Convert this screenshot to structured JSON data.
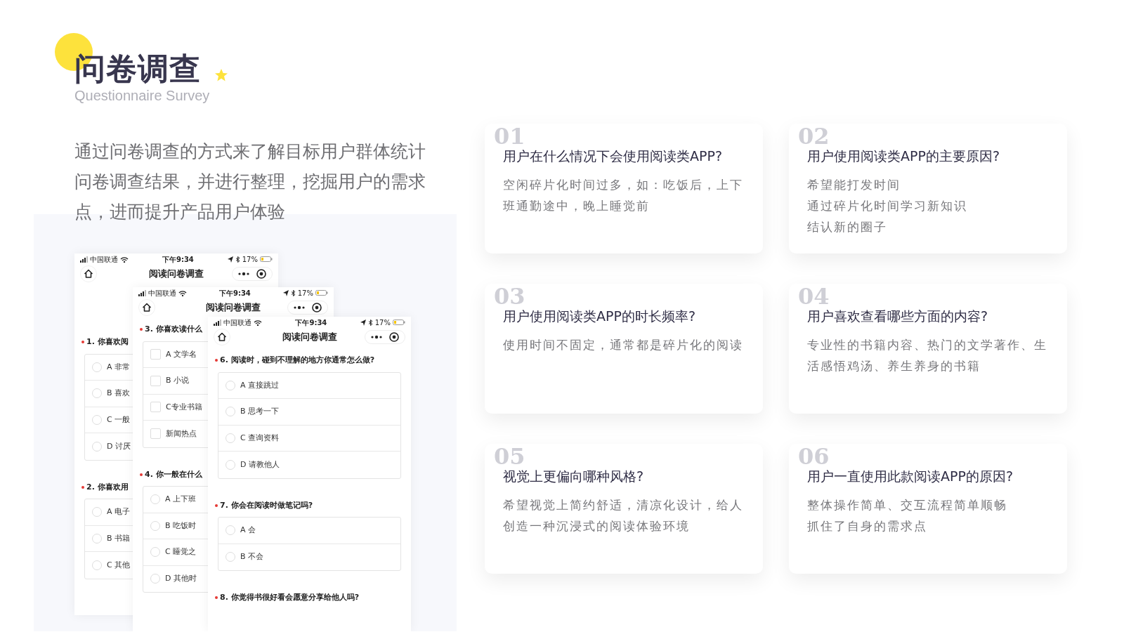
{
  "header": {
    "title": "问卷调查",
    "subtitle": "Questionnaire Survey"
  },
  "intro": "通过问卷调查的方式来了解目标用户群体统计问卷调查结果，并进行整理，挖掘用户的需求点，进而提升产品用户体验",
  "phones": [
    {
      "status": {
        "carrier": "中国联通",
        "time": "下午9:34",
        "battery": "17%"
      },
      "title": "阅读问卷调查",
      "questions": [
        {
          "text": "1. 你喜欢阅",
          "kind": "radio",
          "options": [
            {
              "label": "A 非常",
              "selected": false
            },
            {
              "label": "B 喜欢",
              "selected": false
            },
            {
              "label": "C 一般",
              "selected": false
            },
            {
              "label": "D 讨厌",
              "selected": false
            }
          ]
        },
        {
          "text": "2. 你喜欢用",
          "kind": "radio",
          "options": [
            {
              "label": "A 电子",
              "selected": false
            },
            {
              "label": "B 书籍",
              "selected": false
            },
            {
              "label": "C 其他",
              "selected": false
            }
          ]
        }
      ]
    },
    {
      "status": {
        "carrier": "中国联通",
        "time": "下午9:34",
        "battery": "17%"
      },
      "title": "阅读问卷调查",
      "questions": [
        {
          "text": "3. 你喜欢读什么",
          "kind": "checkbox",
          "options": [
            {
              "label": "A 文学名",
              "selected": false
            },
            {
              "label": "B 小说",
              "selected": false
            },
            {
              "label": "C专业书籍",
              "selected": false
            },
            {
              "label": "新闻热点",
              "selected": false
            }
          ]
        },
        {
          "text": "4. 你一般在什么",
          "kind": "radio",
          "options": [
            {
              "label": "A 上下班",
              "selected": false
            },
            {
              "label": "B 吃饭时",
              "selected": false
            },
            {
              "label": "C 睡觉之",
              "selected": false
            },
            {
              "label": "D 其他时",
              "selected": false
            }
          ]
        }
      ]
    },
    {
      "status": {
        "carrier": "中国联通",
        "time": "下午9:34",
        "battery": "17%"
      },
      "title": "阅读问卷调查",
      "questions": [
        {
          "text": "6. 阅读时，碰到不理解的地方你通常怎么做?",
          "kind": "radio",
          "options": [
            {
              "label": "A 直接跳过",
              "selected": false
            },
            {
              "label": "B 思考一下",
              "selected": false
            },
            {
              "label": "C 查询资料",
              "selected": false
            },
            {
              "label": "D 请教他人",
              "selected": false
            }
          ]
        },
        {
          "text": "7. 你会在阅读时做笔记吗?",
          "kind": "radio",
          "options": [
            {
              "label": "A 会",
              "selected": false
            },
            {
              "label": "B 不会",
              "selected": false
            }
          ]
        },
        {
          "text": "8. 你觉得书很好看会愿意分享给他人吗?"
        }
      ]
    }
  ],
  "cards": [
    {
      "number": "01",
      "question": "用户在什么情况下会使用阅读类APP?",
      "answer_lines": [
        "空闲碎片化时间过多，如：吃饭后，上下班通勤途中，晚上睡觉前"
      ]
    },
    {
      "number": "02",
      "question": "用户使用阅读类APP的主要原因?",
      "answer_lines": [
        "希望能打发时间",
        "通过碎片化时间学习新知识",
        "结认新的圈子"
      ]
    },
    {
      "number": "03",
      "question": "用户使用阅读类APP的时长频率?",
      "answer_lines": [
        "使用时间不固定，通常都是碎片化的阅读"
      ]
    },
    {
      "number": "04",
      "question": "用户喜欢查看哪些方面的内容?",
      "answer_lines": [
        "专业性的书籍内容、热门的文学著作、生活感悟鸡汤、养生养身的书籍"
      ]
    },
    {
      "number": "05",
      "question": "视觉上更偏向哪种风格?",
      "answer_lines": [
        "希望视觉上简约舒适，清凉化设计，给人创造一种沉浸式的阅读体验环境"
      ]
    },
    {
      "number": "06",
      "question": "用户一直使用此款阅读APP的原因?",
      "answer_lines": [
        "整体操作简单、交互流程简单顺畅",
        "抓住了自身的需求点"
      ]
    }
  ]
}
